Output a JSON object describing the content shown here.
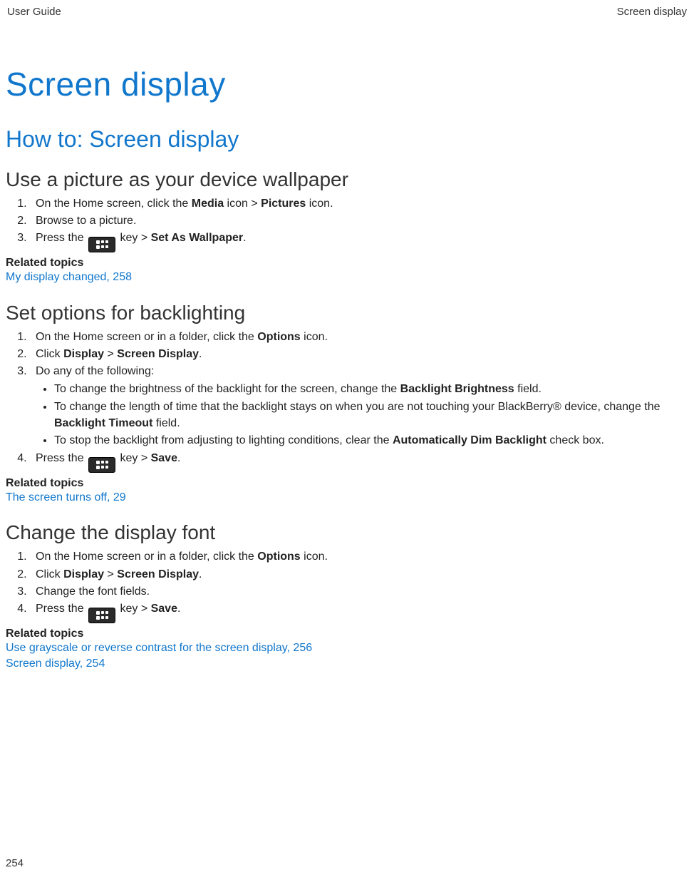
{
  "header": {
    "left": "User Guide",
    "right": "Screen display"
  },
  "h1": "Screen display",
  "h2": "How to: Screen display",
  "sections": {
    "wallpaper": {
      "title": "Use a picture as your device wallpaper",
      "steps": {
        "s1_a": "On the Home screen, click the ",
        "s1_b": "Media",
        "s1_c": " icon > ",
        "s1_d": "Pictures",
        "s1_e": " icon.",
        "s2": "Browse to a picture.",
        "s3_a": "Press the ",
        "s3_b": " key > ",
        "s3_c": "Set As Wallpaper",
        "s3_d": "."
      },
      "related_label": "Related topics",
      "link1": "My display changed, 258"
    },
    "backlight": {
      "title": "Set options for backlighting",
      "steps": {
        "s1_a": "On the Home screen or in a folder, click the ",
        "s1_b": "Options",
        "s1_c": " icon.",
        "s2_a": "Click ",
        "s2_b": "Display",
        "s2_c": " > ",
        "s2_d": "Screen Display",
        "s2_e": ".",
        "s3": "Do any of the following:",
        "b1_a": "To change the brightness of the backlight for the screen, change the ",
        "b1_b": "Backlight Brightness",
        "b1_c": " field.",
        "b2_a": "To change the length of time that the backlight stays on when you are not touching your BlackBerry® device, change the ",
        "b2_b": "Backlight Timeout",
        "b2_c": " field.",
        "b3_a": "To stop the backlight from adjusting to lighting conditions, clear the ",
        "b3_b": "Automatically Dim Backlight",
        "b3_c": " check box.",
        "s4_a": "Press the ",
        "s4_b": " key > ",
        "s4_c": "Save",
        "s4_d": "."
      },
      "related_label": "Related topics",
      "link1": "The screen turns off, 29"
    },
    "font": {
      "title": "Change the display font",
      "steps": {
        "s1_a": "On the Home screen or in a folder, click the ",
        "s1_b": "Options",
        "s1_c": " icon.",
        "s2_a": "Click ",
        "s2_b": "Display",
        "s2_c": " > ",
        "s2_d": "Screen Display",
        "s2_e": ".",
        "s3": "Change the font fields.",
        "s4_a": "Press the ",
        "s4_b": " key > ",
        "s4_c": "Save",
        "s4_d": "."
      },
      "related_label": "Related topics",
      "link1": "Use grayscale or reverse contrast for the screen display, 256",
      "link2": "Screen display, 254"
    }
  },
  "page_number": "254"
}
